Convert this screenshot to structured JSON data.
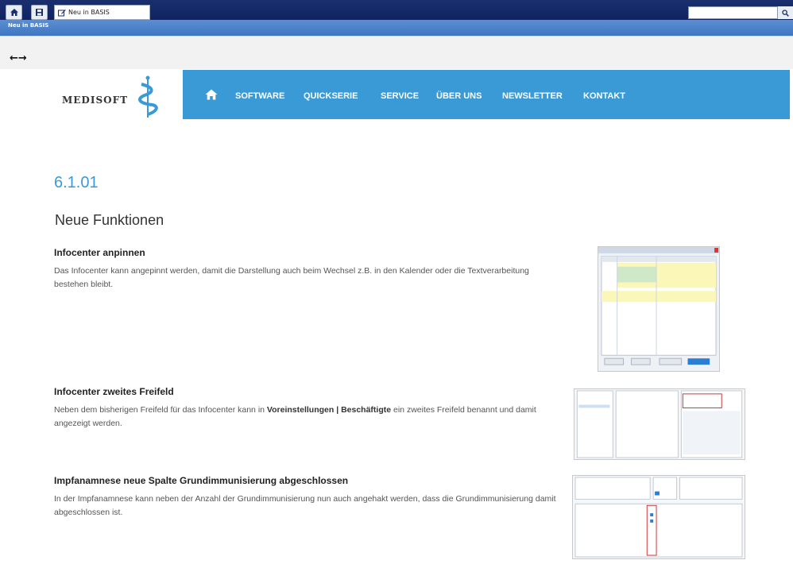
{
  "browser": {
    "tab_label": "Neu in BASIS",
    "subtitle": "Neu in BASIS",
    "nav_arrows": "←→"
  },
  "header": {
    "logo_text": "MEDISOFT",
    "nav": [
      "SOFTWARE",
      "QUICKSERIE",
      "SERVICE",
      "ÜBER UNS",
      "NEWSLETTER",
      "KONTAKT"
    ]
  },
  "main": {
    "version": "6.1.01",
    "section_title": "Neue Funktionen",
    "items": [
      {
        "title": "Infocenter anpinnen",
        "text": "Das Infocenter kann angepinnt werden, damit die Darstellung auch beim Wechsel z.B. in den Kalender oder die Textverarbeitung bestehen bleibt."
      },
      {
        "title": "Infocenter zweites Freifeld",
        "text_pre": "Neben dem bisherigen Freifeld für das Infocenter kann in ",
        "text_bold": "Voreinstellungen | Beschäftigte",
        "text_post": " ein zweites Freifeld benannt und damit angezeigt werden."
      },
      {
        "title": "Impfanamnese neue Spalte Grundimmunisierung abgeschlossen",
        "text": "In der Impfanamnese kann neben der Anzahl der Grundimmunisierung nun auch angehakt werden, dass die Grundimmunisierung damit abgeschlossen ist."
      }
    ]
  },
  "colors": {
    "accent": "#3a9ad6",
    "topbar": "#0f2460",
    "subbar": "#4a82c8"
  },
  "icons": [
    "home-icon",
    "save-icon",
    "edit-icon",
    "search-icon",
    "back-arrow-icon",
    "forward-arrow-icon"
  ]
}
